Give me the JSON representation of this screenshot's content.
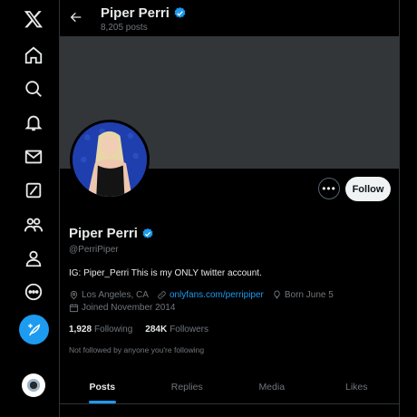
{
  "nav": {
    "items": [
      {
        "icon": "x-logo-icon"
      },
      {
        "icon": "home-icon"
      },
      {
        "icon": "search-icon"
      },
      {
        "icon": "bell-icon"
      },
      {
        "icon": "mail-icon"
      },
      {
        "icon": "grok-icon"
      },
      {
        "icon": "communities-icon"
      },
      {
        "icon": "profile-icon"
      },
      {
        "icon": "more-circle-icon"
      }
    ],
    "compose_icon": "feather-plus-icon",
    "account_avatar": "account-avatar"
  },
  "header": {
    "name": "Piper Perri",
    "posts": "8,205 posts"
  },
  "profile": {
    "name": "Piper Perri",
    "handle": "@PerriPiper",
    "bio": "IG: Piper_Perri This is my ONLY twitter account.",
    "location": "Los Angeles, CA",
    "link": "onlyfans.com/perripiper",
    "born": "Born June 5",
    "joined": "Joined November 2014",
    "following_count": "1,928",
    "following_label": "Following",
    "followers_count": "284K",
    "followers_label": "Followers",
    "followed_by": "Not followed by anyone you're following"
  },
  "actions": {
    "more": "•••",
    "follow": "Follow"
  },
  "tabs": [
    "Posts",
    "Replies",
    "Media",
    "Likes"
  ],
  "colors": {
    "accent": "#1d9bf0",
    "background": "#000000",
    "banner": "#333639",
    "muted_text": "#71767b"
  }
}
